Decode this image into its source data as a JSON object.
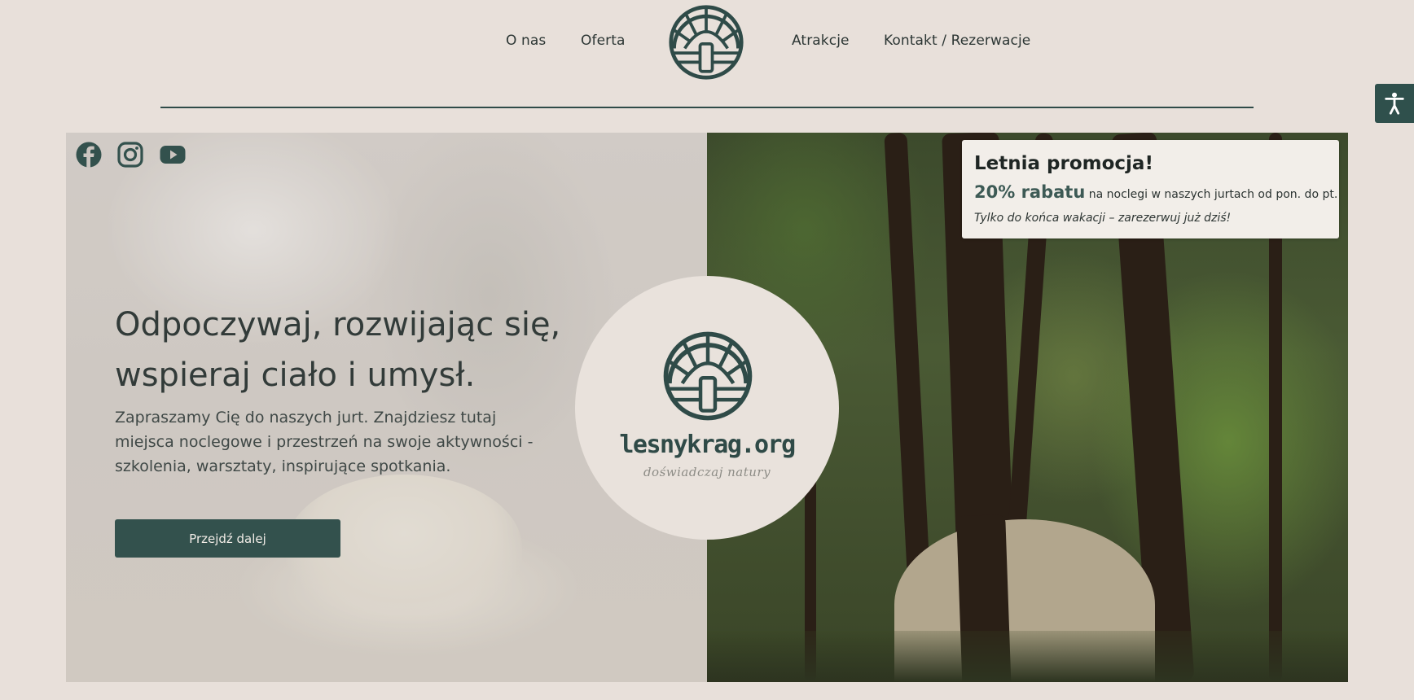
{
  "nav": {
    "items": [
      {
        "label": "O nas"
      },
      {
        "label": "Oferta"
      },
      {
        "label": "Atrakcje"
      },
      {
        "label": "Kontakt / Rezerwacje"
      }
    ],
    "logo_icon": "yurt-logo-icon"
  },
  "accessibility": {
    "icon": "accessibility-icon"
  },
  "social": [
    {
      "icon": "facebook-icon"
    },
    {
      "icon": "instagram-icon"
    },
    {
      "icon": "youtube-icon"
    }
  ],
  "hero": {
    "title_line1": "Odpoczywaj, rozwijając się,",
    "title_line2": "wspieraj ciało i umysł.",
    "text_line1": "Zapraszamy Cię do naszych jurt. Znajdziesz tutaj",
    "text_line2": "miejsca noclegowe i przestrzeń na swoje aktywności -",
    "text_line3": "szkolenia, warsztaty, inspirujące spotkania.",
    "cta_label": "Przejdź dalej"
  },
  "promo": {
    "title": "Letnia promocja!",
    "discount": "20% rabatu",
    "description": " na noclegi w naszych jurtach od pon. do pt.",
    "note": "Tylko do końca wakacji – zarezerwuj już dziś!"
  },
  "badge": {
    "name": "lesnykrag.org",
    "tagline": "doświadczaj natury"
  },
  "colors": {
    "accent": "#33514d",
    "background": "#e8e0da"
  }
}
